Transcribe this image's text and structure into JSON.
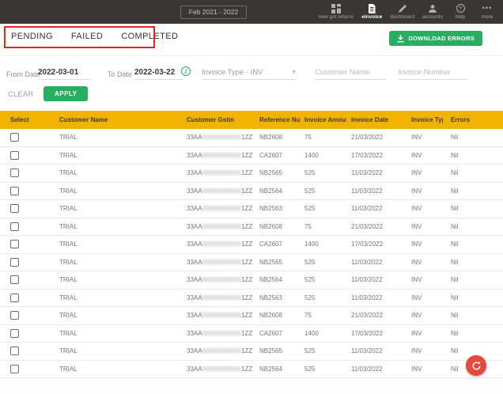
{
  "topbar": {
    "period_selector": "Feb 2021 - 2022",
    "nav_items": [
      {
        "label": "new gst returns",
        "icon": "grid-icon",
        "active": false
      },
      {
        "label": "einvoice",
        "icon": "document-icon",
        "active": true
      },
      {
        "label": "dashboard",
        "icon": "pencil-icon",
        "active": false
      },
      {
        "label": "accounts",
        "icon": "person-icon",
        "active": false
      },
      {
        "label": "help",
        "icon": "help-icon",
        "active": false
      },
      {
        "label": "more",
        "icon": "more-dots-icon",
        "active": false
      }
    ]
  },
  "tabs": {
    "pending": "PENDING",
    "failed": "FAILED",
    "completed": "COMPLETED"
  },
  "download_errors_button": "DOWNLOAD ERRORS",
  "filters": {
    "from_date_label": "From Date",
    "from_date_value": "2022-03-01",
    "to_date_label": "To Date",
    "to_date_value": "2022-03-22",
    "info_icon": "i",
    "invoice_type_value": "Invoice Type - INV",
    "customer_name_placeholder": "Customer Name",
    "invoice_number_placeholder": "Invoice Number",
    "clear_label": "CLEAR",
    "apply_label": "APPLY"
  },
  "table": {
    "columns": [
      "Select",
      "Customer Name",
      "Customer Gstin",
      "Reference Number",
      "Invoice Amount",
      "Invoice Date",
      "Invoice Type",
      "Errors"
    ],
    "rows": [
      {
        "customer_name": "TRIAL",
        "gstin_prefix": "33AA",
        "gstin_masked": "0000000000",
        "gstin_suffix": "1ZZ",
        "reference_number": "NB2608",
        "invoice_amount": "75",
        "invoice_date": "21/03/2022",
        "invoice_type": "INV",
        "errors": "Nil"
      },
      {
        "customer_name": "TRIAL",
        "gstin_prefix": "33AA",
        "gstin_masked": "0000000000",
        "gstin_suffix": "1ZZ",
        "reference_number": "CA2607",
        "invoice_amount": "1400",
        "invoice_date": "17/03/2022",
        "invoice_type": "INV",
        "errors": "Nil"
      },
      {
        "customer_name": "TRIAL",
        "gstin_prefix": "33AA",
        "gstin_masked": "0000000000",
        "gstin_suffix": "1ZZ",
        "reference_number": "NB2565",
        "invoice_amount": "525",
        "invoice_date": "11/03/2022",
        "invoice_type": "INV",
        "errors": "Nil"
      },
      {
        "customer_name": "TRIAL",
        "gstin_prefix": "33AA",
        "gstin_masked": "0000000000",
        "gstin_suffix": "1ZZ",
        "reference_number": "NB2564",
        "invoice_amount": "525",
        "invoice_date": "11/03/2022",
        "invoice_type": "INV",
        "errors": "Nil"
      },
      {
        "customer_name": "TRIAL",
        "gstin_prefix": "33AA",
        "gstin_masked": "0000000000",
        "gstin_suffix": "1ZZ",
        "reference_number": "NB2563",
        "invoice_amount": "525",
        "invoice_date": "11/03/2022",
        "invoice_type": "INV",
        "errors": "Nil"
      },
      {
        "customer_name": "TRIAL",
        "gstin_prefix": "33AA",
        "gstin_masked": "0000000000",
        "gstin_suffix": "1ZZ",
        "reference_number": "NB2608",
        "invoice_amount": "75",
        "invoice_date": "21/03/2022",
        "invoice_type": "INV",
        "errors": "Nil"
      },
      {
        "customer_name": "TRIAL",
        "gstin_prefix": "33AA",
        "gstin_masked": "0000000000",
        "gstin_suffix": "1ZZ",
        "reference_number": "CA2607",
        "invoice_amount": "1400",
        "invoice_date": "17/03/2022",
        "invoice_type": "INV",
        "errors": "Nil"
      },
      {
        "customer_name": "TRIAL",
        "gstin_prefix": "33AA",
        "gstin_masked": "0000000000",
        "gstin_suffix": "1ZZ",
        "reference_number": "NB2565",
        "invoice_amount": "525",
        "invoice_date": "11/03/2022",
        "invoice_type": "INV",
        "errors": "Nil"
      },
      {
        "customer_name": "TRIAL",
        "gstin_prefix": "33AA",
        "gstin_masked": "0000000000",
        "gstin_suffix": "1ZZ",
        "reference_number": "NB2564",
        "invoice_amount": "525",
        "invoice_date": "11/03/2022",
        "invoice_type": "INV",
        "errors": "Nil"
      },
      {
        "customer_name": "TRIAL",
        "gstin_prefix": "33AA",
        "gstin_masked": "0000000000",
        "gstin_suffix": "1ZZ",
        "reference_number": "NB2563",
        "invoice_amount": "525",
        "invoice_date": "11/03/2022",
        "invoice_type": "INV",
        "errors": "Nil"
      },
      {
        "customer_name": "TRIAL",
        "gstin_prefix": "33AA",
        "gstin_masked": "0000000000",
        "gstin_suffix": "1ZZ",
        "reference_number": "NB2608",
        "invoice_amount": "75",
        "invoice_date": "21/03/2022",
        "invoice_type": "INV",
        "errors": "Nil"
      },
      {
        "customer_name": "TRIAL",
        "gstin_prefix": "33AA",
        "gstin_masked": "0000000000",
        "gstin_suffix": "1ZZ",
        "reference_number": "CA2607",
        "invoice_amount": "1400",
        "invoice_date": "17/03/2022",
        "invoice_type": "INV",
        "errors": "Nil"
      },
      {
        "customer_name": "TRIAL",
        "gstin_prefix": "33AA",
        "gstin_masked": "0000000000",
        "gstin_suffix": "1ZZ",
        "reference_number": "NB2565",
        "invoice_amount": "525",
        "invoice_date": "11/03/2022",
        "invoice_type": "INV",
        "errors": "Nil"
      },
      {
        "customer_name": "TRIAL",
        "gstin_prefix": "33AA",
        "gstin_masked": "0000000000",
        "gstin_suffix": "1ZZ",
        "reference_number": "NB2564",
        "invoice_amount": "525",
        "invoice_date": "11/03/2022",
        "invoice_type": "INV",
        "errors": "Nil"
      }
    ]
  },
  "fab": {
    "icon": "refresh-icon"
  },
  "colors": {
    "topbar_bg": "#3a3633",
    "accent_green": "#27ae60",
    "table_header_yellow": "#f2b200",
    "annotation_red": "#df2721",
    "fab_red": "#e8473b"
  }
}
